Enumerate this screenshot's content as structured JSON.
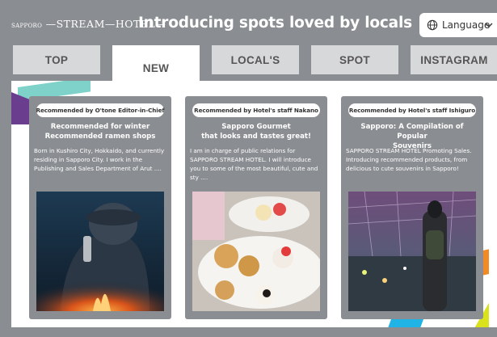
{
  "header": {
    "logo_small": "SAPPORO",
    "logo_main": "—STREAM—HOTEL—",
    "headline": "Introducing spots loved by locals",
    "language_label": "Language"
  },
  "tabs": [
    {
      "label": "TOP",
      "active": false
    },
    {
      "label": "NEW",
      "active": true
    },
    {
      "label": "LOCAL'S",
      "active": false
    },
    {
      "label": "SPOT",
      "active": false
    },
    {
      "label": "INSTAGRAM",
      "active": false
    }
  ],
  "cards": [
    {
      "badge": "Recommended by O'tone Editor-in-Chief",
      "title": "Recommended for winter\nRecommended ramen shops",
      "description": "Born in Kushiro City, Hokkaido, and currently residing in Sapporo City. I work in the Publishing and Sales Department of Arut ...."
    },
    {
      "badge": "Recommended by Hotel's staff Nakano",
      "title": "Sapporo Gourmet\nthat looks and tastes great!",
      "description": "I am in charge of public relations for SAPPORO STREAM HOTEL. I will introduce you to some of the most beautiful, cute and sty ...."
    },
    {
      "badge": "Recommended by Hotel's staff Ishiguro",
      "title": "Sapporo: A Compilation of Popular\nSouvenirs",
      "description": "SAPPORO STREAM HOTEL Promoting Sales. Introducing recommended products, from delicious to cute souvenirs in Sapporo!"
    }
  ],
  "colors": {
    "background": "#8a8d91",
    "tab_inactive": "#d7d8da",
    "tab_active": "#ffffff",
    "accent_teal": "#7fd2c9",
    "accent_purple": "#6a3d8f",
    "accent_orange": "#f08a24",
    "accent_lime": "#d9e21a",
    "accent_blue": "#1fb3e6"
  },
  "icons": {
    "language": "globe-icon",
    "dropdown": "chevron-down-icon"
  }
}
